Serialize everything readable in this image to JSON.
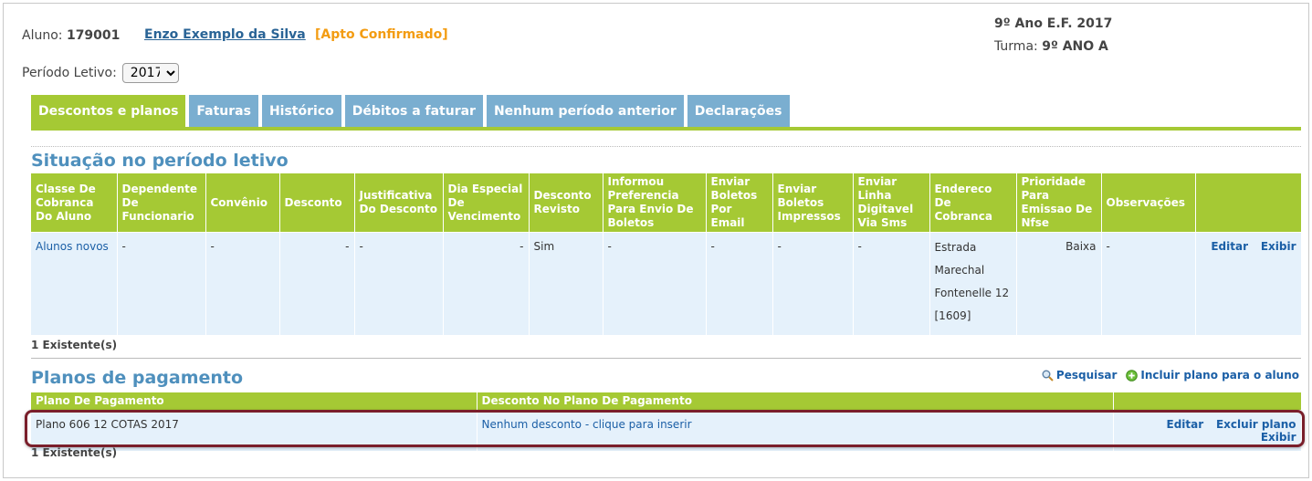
{
  "student": {
    "aluno_label": "Aluno:",
    "id": "179001",
    "name": "Enzo Exemplo da Silva",
    "status": "[Apto Confirmado]",
    "grade": "9º Ano E.F. 2017",
    "turma_label": "Turma:",
    "turma": "9º ANO A"
  },
  "period": {
    "label": "Período Letivo:",
    "selected": "2017"
  },
  "tabs": [
    {
      "label": "Descontos e planos"
    },
    {
      "label": "Faturas"
    },
    {
      "label": "Histórico"
    },
    {
      "label": "Débitos a faturar"
    },
    {
      "label": "Nenhum período anterior"
    },
    {
      "label": "Declarações"
    }
  ],
  "situacao": {
    "title": "Situação no período letivo",
    "headers": [
      "Classe De Cobranca Do Aluno",
      "Dependente De Funcionario",
      "Convênio",
      "Desconto",
      "Justificativa Do Desconto",
      "Dia Especial De Vencimento",
      "Desconto Revisto",
      "Informou Preferencia Para Envio De Boletos",
      "Enviar Boletos Por Email",
      "Enviar Boletos Impressos",
      "Enviar Linha Digitavel Via Sms",
      "Endereco De Cobranca",
      "Prioridade Para Emissao De Nfse",
      "Observações"
    ],
    "row": {
      "classe": "Alunos novos",
      "dependente": "-",
      "convenio": "-",
      "desconto": "-",
      "justificativa": "-",
      "dia_especial": "-",
      "desconto_revisto": "Sim",
      "informou": "-",
      "email": "-",
      "impressos": "-",
      "sms": "-",
      "endereco_1": "Estrada",
      "endereco_2": "Marechal",
      "endereco_3": "Fontenelle 12",
      "endereco_4": "[1609]",
      "prioridade": "Baixa",
      "observacoes": "-",
      "edit": "Editar",
      "view": "Exibir"
    },
    "count": "1 Existente(s)"
  },
  "planos": {
    "title": "Planos de pagamento",
    "search": "Pesquisar",
    "add": "Incluir plano para o aluno",
    "headers": [
      "Plano De Pagamento",
      "Desconto No Plano De Pagamento"
    ],
    "row": {
      "plano": "Plano 606 12 COTAS 2017",
      "desconto": "Nenhum desconto - clique para inserir",
      "edit": "Editar",
      "delete": "Excluir plano",
      "view": "Exibir"
    },
    "count": "1 Existente(s)"
  },
  "colors": {
    "green": "#a5c934",
    "blue_tab": "#7aaed0",
    "title_blue": "#4f90bd",
    "highlight": "#7a1f2b"
  }
}
